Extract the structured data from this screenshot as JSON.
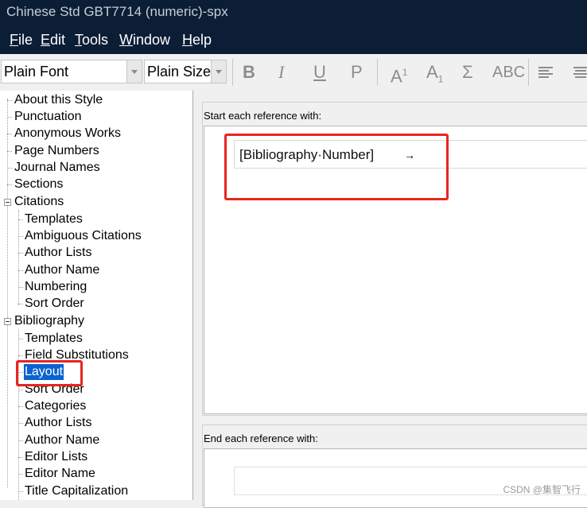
{
  "window": {
    "title": "Chinese Std GBT7714 (numeric)-spx"
  },
  "menu": [
    "File",
    "Edit",
    "Tools",
    "Window",
    "Help"
  ],
  "toolbar": {
    "font_value": "Plain Font",
    "size_value": "Plain Size",
    "bold": "B",
    "italic": "I",
    "underline": "U",
    "plain": "P",
    "superscript": "A",
    "superscript_mark": "1",
    "subscript": "A",
    "subscript_mark": "1",
    "symbol": "Σ",
    "smallcaps": "ABC"
  },
  "tree": {
    "items": [
      "About this Style",
      "Punctuation",
      "Anonymous Works",
      "Page Numbers",
      "Journal Names",
      "Sections",
      "Citations",
      "Templates",
      "Ambiguous Citations",
      "Author Lists",
      "Author Name",
      "Numbering",
      "Sort Order",
      "Bibliography",
      "Templates",
      "Field Substitutions",
      "Layout",
      "Sort Order",
      "Categories",
      "Author Lists",
      "Author Name",
      "Editor Lists",
      "Editor Name",
      "Title Capitalization"
    ],
    "selected": "Layout"
  },
  "layout": {
    "start_label": "Start each reference with:",
    "start_value": "[Bibliography·Number]",
    "start_tab": "→",
    "end_label": "End each reference with:"
  },
  "watermark": "CSDN @集智飞行"
}
